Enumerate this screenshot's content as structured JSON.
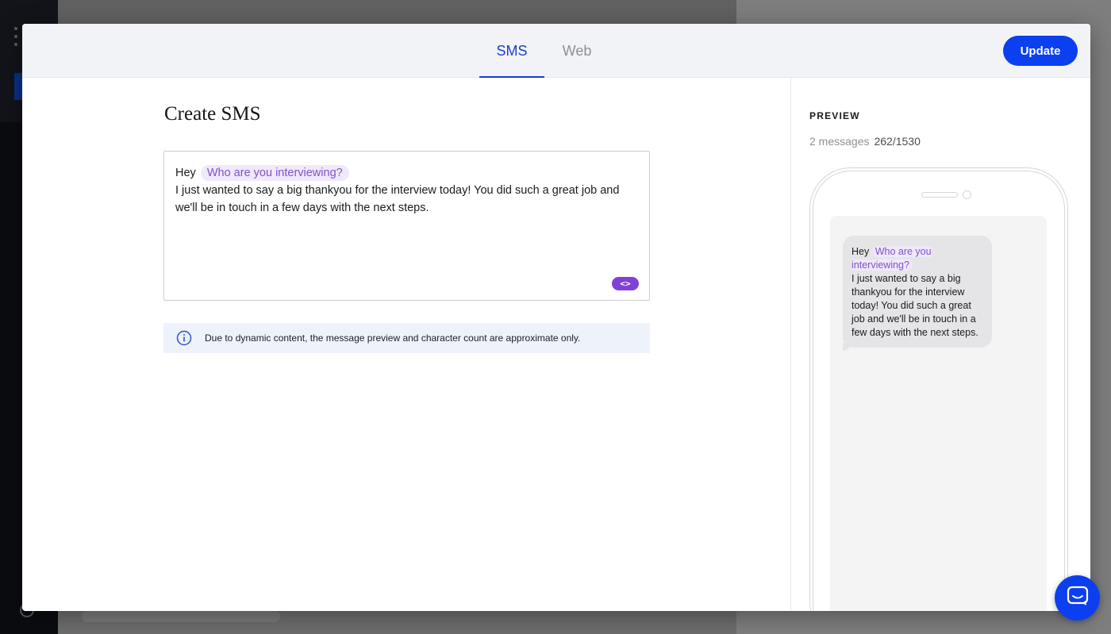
{
  "tabs": [
    {
      "label": "SMS",
      "active": true
    },
    {
      "label": "Web",
      "active": false
    }
  ],
  "header": {
    "update_label": "Update"
  },
  "editor": {
    "title": "Create SMS",
    "greeting": "Hey",
    "placeholder_chip": "Who are you interviewing?",
    "body": "I just wanted to say a big thankyou for the interview today! You did such a great job and we'll be in touch in a few days with the next steps.",
    "code_button": "<>"
  },
  "notice": {
    "text": "Due to dynamic content, the message preview and character count are approximate only."
  },
  "preview": {
    "label": "PREVIEW",
    "messages": "2 messages",
    "chars": "262/1530",
    "bubble": {
      "greeting": "Hey",
      "chip": "Who are you interviewing?",
      "body": "I just wanted to say a big thankyou for the interview today! You did such a great job and we'll be in touch in a few days with the next steps."
    }
  },
  "colors": {
    "accent": "#0b3ff0",
    "tab_active": "#1c3fc9",
    "chip_text": "#8351c8",
    "chip_bg": "#f0e9fb",
    "code_button": "#8042d6",
    "notice_bg": "#eef2fb"
  },
  "icons": {
    "notice": "info-icon",
    "launcher": "chat-icon"
  }
}
